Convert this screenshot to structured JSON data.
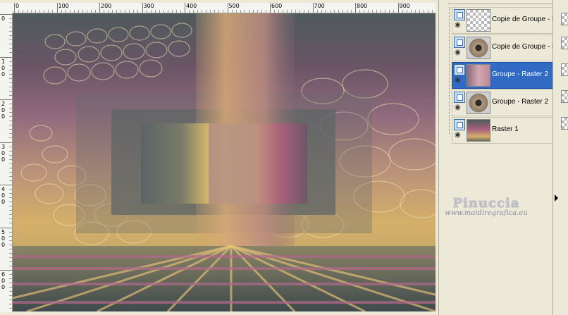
{
  "ruler": {
    "top_labels": [
      "0",
      "100",
      "200",
      "300",
      "400",
      "500",
      "600",
      "700",
      "800",
      "900"
    ],
    "left_labels": [
      "0",
      "100",
      "200",
      "300",
      "400",
      "500",
      "600"
    ]
  },
  "layers": [
    {
      "name": "Copie de Groupe - R",
      "thumb": "checker-dots",
      "selected": false
    },
    {
      "name": "Copie de Groupe - R",
      "thumb": "pattern-dark",
      "selected": false
    },
    {
      "name": "Groupe - Raster 2",
      "thumb": "pink-gradient",
      "selected": true
    },
    {
      "name": "Groupe - Raster 2",
      "thumb": "pattern-dark",
      "selected": false
    },
    {
      "name": "Raster 1",
      "thumb": "sunset-gradient",
      "selected": false
    }
  ],
  "watermark": {
    "title": "Pinuccia",
    "url": "www.maidiregrafica.eu"
  },
  "colors": {
    "selection": "#316ac5",
    "panel_bg": "#ece9d8",
    "accent_pink": "#a8607a",
    "accent_gold": "#d4b06a",
    "accent_teal": "#4e5a5c"
  }
}
